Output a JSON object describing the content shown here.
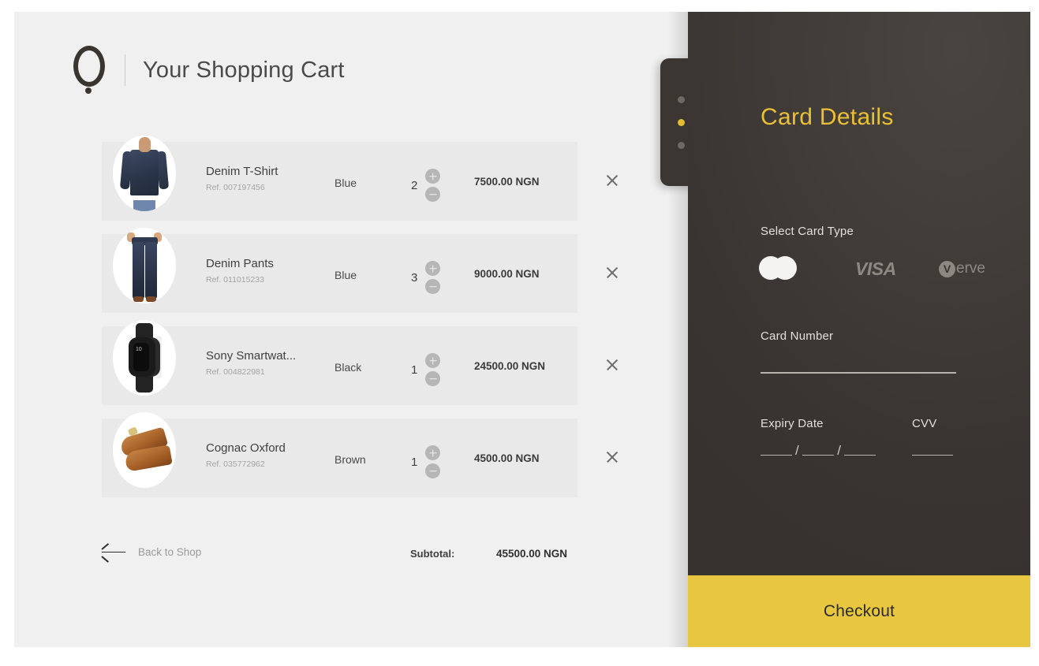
{
  "header": {
    "logo_icon": "q-logo-icon",
    "title": "Your Shopping Cart"
  },
  "cart": {
    "items": [
      {
        "image": "denim-shirt-thumbnail",
        "name": "Denim T-Shirt",
        "ref": "Ref. 007197456",
        "color": "Blue",
        "qty": "2",
        "price": "7500.00 NGN"
      },
      {
        "image": "denim-pants-thumbnail",
        "name": "Denim Pants",
        "ref": "Ref. 011015233",
        "color": "Blue",
        "qty": "3",
        "price": "9000.00 NGN"
      },
      {
        "image": "smartwatch-thumbnail",
        "name": "Sony Smartwat...",
        "ref": "Ref. 004822981",
        "color": "Black",
        "qty": "1",
        "price": "24500.00 NGN"
      },
      {
        "image": "oxford-shoe-thumbnail",
        "name": "Cognac Oxford",
        "ref": "Ref. 035772962",
        "color": "Brown",
        "qty": "1",
        "price": "4500.00 NGN"
      }
    ],
    "footer": {
      "back_label": "Back to Shop",
      "subtotal_label": "Subtotal:",
      "subtotal_value": "45500.00 NGN"
    }
  },
  "payment": {
    "title": "Card Details",
    "card_type_label": "Select Card Type",
    "card_types": [
      {
        "name": "mastercard",
        "label": "",
        "selected": true
      },
      {
        "name": "visa",
        "label": "VISA",
        "selected": false
      },
      {
        "name": "verve",
        "label": "erve",
        "mark": "V",
        "selected": false
      }
    ],
    "card_number_label": "Card Number",
    "card_number_value": "",
    "expiry_label": "Expiry Date",
    "expiry_separator": "/",
    "cvv_label": "CVV",
    "cvv_value": "",
    "checkout_label": "Checkout"
  },
  "side_tab": {
    "dots": [
      "inactive",
      "active",
      "inactive"
    ]
  },
  "colors": {
    "accent_gold": "#e8c63f",
    "panel_dark": "#3a3532",
    "page_bg": "#f0f0f0",
    "row_bg": "#e9e9e9"
  }
}
